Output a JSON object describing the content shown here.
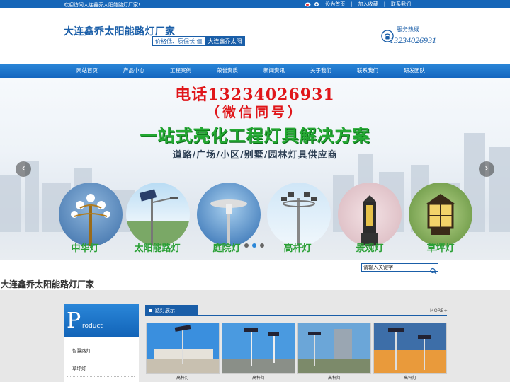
{
  "topbar": {
    "welcome": "欢迎访问大连鑫乔太阳能路灯厂家!",
    "set_home": "设为首页",
    "add_fav": "加入收藏",
    "contact": "联系我们",
    "sep": "|"
  },
  "header": {
    "site_title": "大连鑫乔太阳能路灯厂家",
    "slogan_a": "价格低、质保长 值",
    "slogan_b": "大连鑫乔太阳",
    "hotline_label": "服务热线",
    "hotline_number": "13234026931"
  },
  "nav": [
    "网站首页",
    "产品中心",
    "工程案例",
    "荣誉资质",
    "新闻资讯",
    "关于我们",
    "联系我们",
    "研发团队"
  ],
  "banner": {
    "line1": "电话13234026931",
    "line2": "（微信同号）",
    "line3": "一站式亮化工程灯具解决方案",
    "line4": "道路/广场/小区/别墅/园林灯具供应商",
    "prev_icon": "‹",
    "next_icon": "›",
    "categories": [
      "中华灯",
      "太阳能路灯",
      "庭院灯",
      "高杆灯",
      "景观灯",
      "草坪灯"
    ]
  },
  "search": {
    "value": "请输入关键字"
  },
  "company_name": "大连鑫乔太阳能路灯厂家",
  "sidebar": {
    "head_letter": "P",
    "head_rest": "roduct",
    "items": [
      "智慧路灯",
      "草坪灯"
    ]
  },
  "section": {
    "title": "路灯展示",
    "more": "MORE+"
  },
  "products": [
    {
      "label": "高杆灯"
    },
    {
      "label": "高杆灯"
    },
    {
      "label": "高杆灯"
    },
    {
      "label": "高杆灯"
    }
  ],
  "colors": {
    "brand_blue": "#1a5ea8",
    "banner_red": "#e0161a",
    "banner_green": "#23a832"
  }
}
